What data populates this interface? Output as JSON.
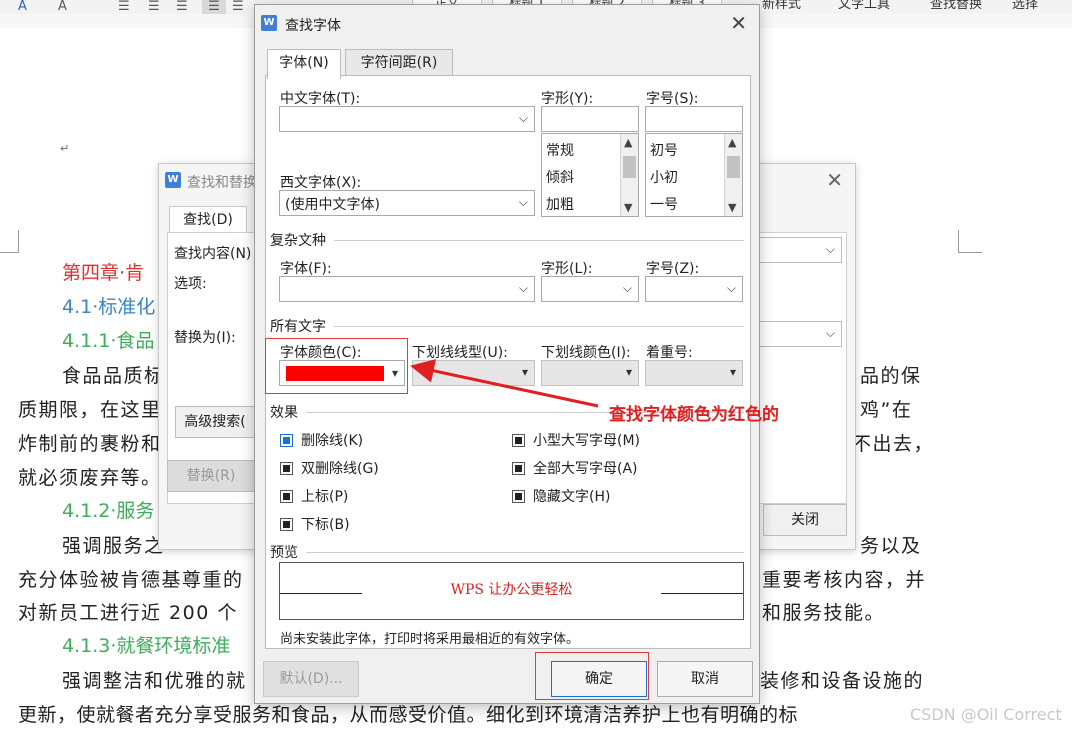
{
  "toolbar": {
    "styles": [
      "正文",
      "标题 1",
      "标题 2",
      "标题 3"
    ],
    "menus": [
      "新样式",
      "文字工具",
      "查找替换",
      "选择"
    ]
  },
  "document": {
    "chapter": "第四章·肯",
    "h41": "4.1·标准化",
    "h411": "4.1.1·食品",
    "p1_a": "食品品质标",
    "p1_a_end": "品的保",
    "p1_b": "质期限，在这里",
    "p1_b_end": "鸡”在",
    "p1_c": "炸制前的裹粉和",
    "p1_c_end": "不出去，",
    "p1_d": "就必须废弃等。",
    "h412": "4.1.2·服务",
    "p2_a": "强调服务之",
    "p2_a_end": "务以及",
    "p2_b": "充分体验被肯德基尊重的",
    "p2_b_end": "重要考核内容，并",
    "p2_c": "对新员工进行近 200 个",
    "p2_c_end": "和服务技能。",
    "h413": "4.1.3·就餐环境标准",
    "p3_a": "强调整洁和优雅的就",
    "p3_a_end": "装修和设备设施的",
    "p3_b": "更新，使就餐者充分享受服务和食品，从而感受价值。细化到环境清洁养护上也有明确的标",
    "para_mark": "↵"
  },
  "find_replace": {
    "title": "查找和替换",
    "tab_find": "查找(D)",
    "find_label": "查找内容(N)",
    "options_label": "选项:",
    "replace_label": "替换为(I):",
    "advanced_btn": "高级搜索(",
    "replace_btn": "替换(R)",
    "close_btn": "关闭"
  },
  "find_font": {
    "title": "查找字体",
    "tab_font": "字体(N)",
    "tab_spacing": "字符间距(R)",
    "cn_font_label": "中文字体(T):",
    "style_label": "字形(Y):",
    "size_label": "字号(S):",
    "style_list": [
      "常规",
      "倾斜",
      "加粗"
    ],
    "size_list": [
      "初号",
      "小初",
      "一号"
    ],
    "west_font_label": "西文字体(X):",
    "west_font_value": "(使用中文字体)",
    "complex_group": "复杂文种",
    "complex_font_label": "字体(F):",
    "complex_style_label": "字形(L):",
    "complex_size_label": "字号(Z):",
    "all_text_group": "所有文字",
    "font_color_label": "字体颜色(C):",
    "font_color_value": "#ff0000",
    "underline_type_label": "下划线线型(U):",
    "underline_color_label": "下划线颜色(I):",
    "emphasis_label": "着重号:",
    "effects_group": "效果",
    "effects_left": [
      "删除线(K)",
      "双删除线(G)",
      "上标(P)",
      "下标(B)"
    ],
    "effects_right": [
      "小型大写字母(M)",
      "全部大写字母(A)",
      "隐藏文字(H)"
    ],
    "preview_group": "预览",
    "preview_text": "WPS 让办公更轻松",
    "preview_color": "#e02020",
    "note": "尚未安装此字体，打印时将采用最相近的有效字体。",
    "default_btn": "默认(D)...",
    "ok_btn": "确定",
    "cancel_btn": "取消"
  },
  "annotation": {
    "text": "查找字体颜色为红色的",
    "color": "#e02020"
  },
  "watermark": "CSDN @Oil Correct"
}
